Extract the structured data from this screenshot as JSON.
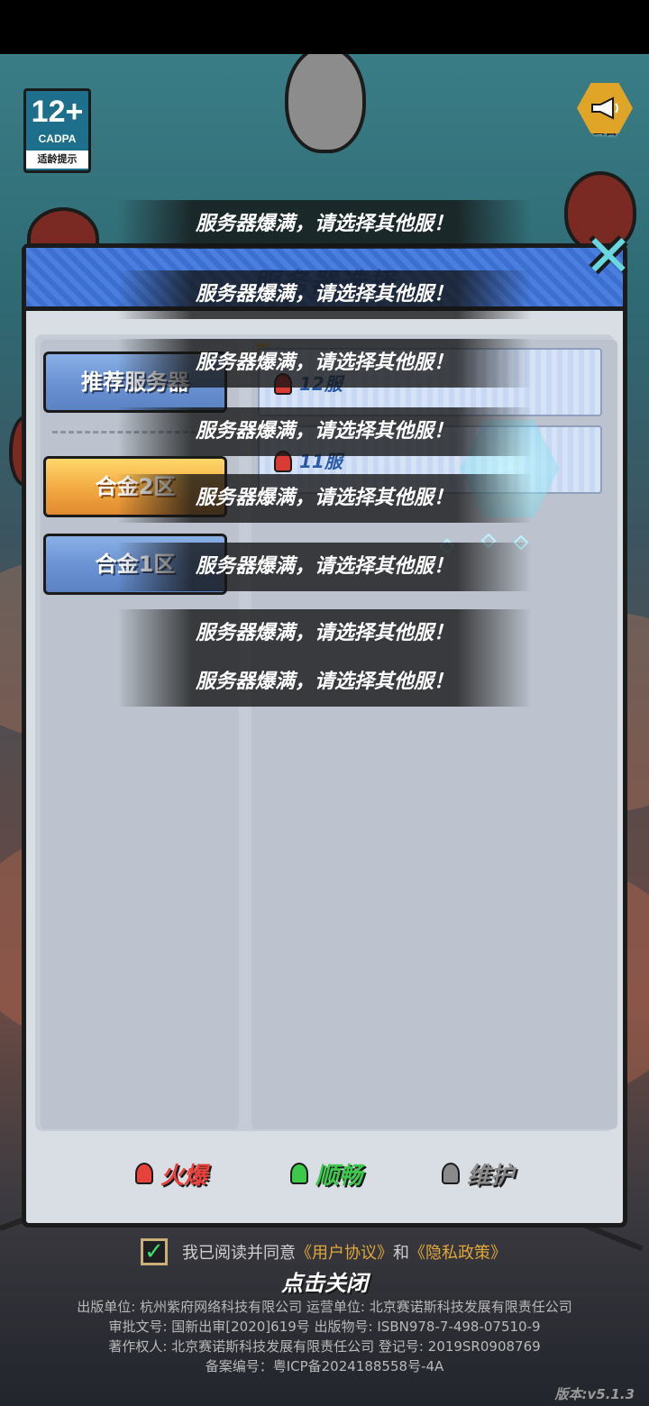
{
  "age_badge": {
    "age": "12+",
    "org": "CADPA",
    "tip": "适龄提示"
  },
  "notice": {
    "icon": "megaphone-icon",
    "label": "公告"
  },
  "panel": {
    "title": "服务器选择",
    "close_icon": "close-x-icon",
    "zones": [
      {
        "label": "推荐服务器",
        "style": "blue"
      },
      {
        "label": "合金2区",
        "style": "gold",
        "selected": true
      },
      {
        "label": "合金1区",
        "style": "blue"
      }
    ],
    "new_tag": "新",
    "servers": [
      {
        "name": "12服",
        "status": "火爆"
      },
      {
        "name": "11服",
        "status": "火爆"
      }
    ]
  },
  "toast_text": "服务器爆满，请选择其他服！",
  "toasts": [
    "服务器爆满，请选择其他服！",
    "服务器爆满，请选择其他服！",
    "服务器爆满，请选择其他服！",
    "服务器爆满，请选择其他服！",
    "服务器爆满，请选择其他服！",
    "服务器爆满，请选择其他服！",
    "服务器爆满，请选择其他服！",
    "服务器爆满，请选择其他服！"
  ],
  "legend": [
    {
      "label": "火爆",
      "color": "#e8403a"
    },
    {
      "label": "顺畅",
      "color": "#3cc84a"
    },
    {
      "label": "维护",
      "color": "#8a8a8a"
    }
  ],
  "agreement": {
    "checked": true,
    "prefix": "我已阅读并同意",
    "user_link": "《用户协议》",
    "and": "和",
    "privacy_link": "《隐私政策》"
  },
  "tap_close": "点击关闭",
  "legal": {
    "line1": "出版单位: 杭州紫府网络科技有限公司   运营单位: 北京赛诺斯科技发展有限责任公司",
    "line2": "审批文号: 国新出审[2020]619号   出版物号: ISBN978-7-498-07510-9",
    "line3": "著作权人: 北京赛诺斯科技发展有限责任公司   登记号: 2019SR0908769",
    "line4": "备案编号：粤ICP备2024188558号-4A"
  },
  "version": "版本:v5.1.3"
}
